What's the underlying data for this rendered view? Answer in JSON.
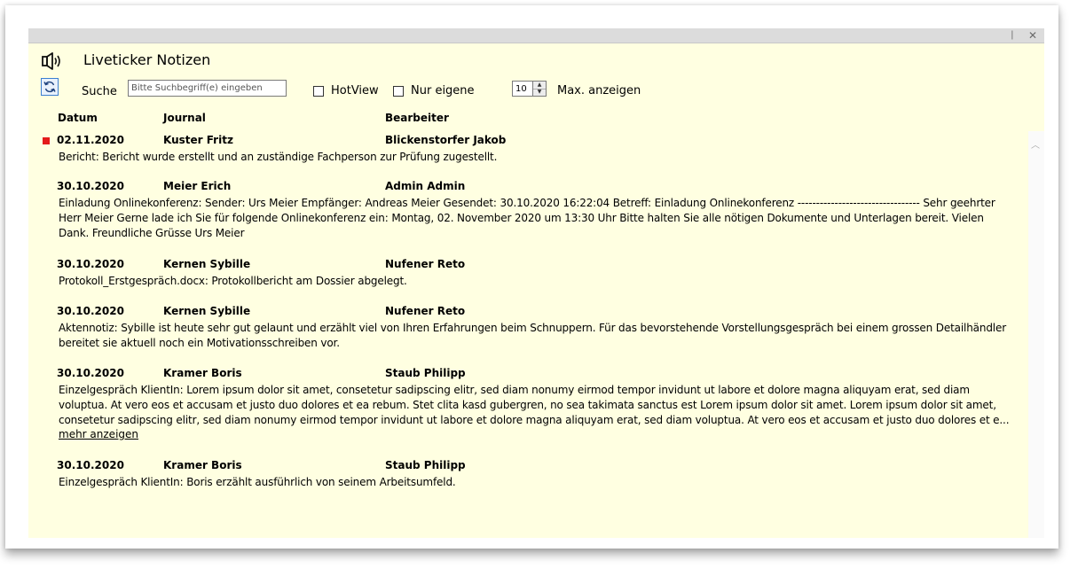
{
  "window": {
    "title": "Liveticker Notizen",
    "pin_glyph": "❘",
    "close_glyph": "✕"
  },
  "icons": {
    "header": "speaker-icon",
    "refresh": "refresh-icon"
  },
  "toolbar": {
    "search_label": "Suche",
    "search_placeholder": "Bitte Suchbegriff(e) eingeben",
    "search_value": "",
    "hotview_label": "HotView",
    "hotview_checked": false,
    "own_label": "Nur eigene",
    "own_checked": false,
    "max_value": "10",
    "max_label": "Max. anzeigen"
  },
  "columns": {
    "date": "Datum",
    "journal": "Journal",
    "editor": "Bearbeiter"
  },
  "colors": {
    "panel_bg": "#ffffe1",
    "marker": "#e41b1b",
    "accent": "#3c7fd1"
  },
  "entries": [
    {
      "date": "02.11.2020",
      "journal": "Kuster Fritz",
      "editor": "Blickenstorfer Jakob",
      "text": "Bericht: Bericht wurde erstellt und an zuständige Fachperson zur Prüfung zugestellt.",
      "marked": true
    },
    {
      "date": "30.10.2020",
      "journal": "Meier Erich",
      "editor": "Admin Admin",
      "text": "Einladung Onlinekonferenz: Sender: Urs Meier Empfänger: Andreas Meier Gesendet: 30.10.2020 16:22:04 Betreff: Einladung Onlinekonferenz --------------------------------- Sehr geehrter Herr Meier Gerne lade ich Sie für folgende Onlinekonferenz ein: Montag, 02. November 2020 um 13:30 Uhr Bitte halten Sie alle nötigen Dokumente und Unterlagen bereit. Vielen Dank. Freundliche Grüsse Urs Meier",
      "marked": false
    },
    {
      "date": "30.10.2020",
      "journal": "Kernen Sybille",
      "editor": "Nufener Reto",
      "text": "Protokoll_Erstgespräch.docx: Protokollbericht am Dossier abgelegt.",
      "marked": false
    },
    {
      "date": "30.10.2020",
      "journal": "Kernen Sybille",
      "editor": "Nufener Reto",
      "text": "Aktennotiz: Sybille ist heute sehr gut gelaunt und erzählt viel von Ihren Erfahrungen beim Schnuppern. Für das bevorstehende Vorstellungsgespräch bei einem grossen Detailhändler bereitet sie aktuell noch ein Motivationsschreiben vor.",
      "marked": false
    },
    {
      "date": "30.10.2020",
      "journal": "Kramer Boris",
      "editor": "Staub Philipp",
      "text": "Einzelgespräch KlientIn: Lorem ipsum dolor sit amet, consetetur sadipscing elitr, sed diam nonumy eirmod tempor invidunt ut labore et dolore magna aliquyam erat, sed diam voluptua. At vero eos et accusam et justo duo dolores et ea rebum. Stet clita kasd gubergren, no sea takimata sanctus est Lorem ipsum dolor sit amet. Lorem ipsum dolor sit amet, consetetur sadipscing elitr, sed diam nonumy eirmod tempor invidunt ut labore et dolore magna aliquyam erat, sed diam voluptua. At vero eos et accusam et justo duo dolores et e...",
      "more_label": "mehr anzeigen",
      "marked": false
    },
    {
      "date": "30.10.2020",
      "journal": "Kramer Boris",
      "editor": "Staub Philipp",
      "text": "Einzelgespräch KlientIn: Boris erzählt ausführlich von seinem Arbeitsumfeld.",
      "marked": false
    }
  ]
}
